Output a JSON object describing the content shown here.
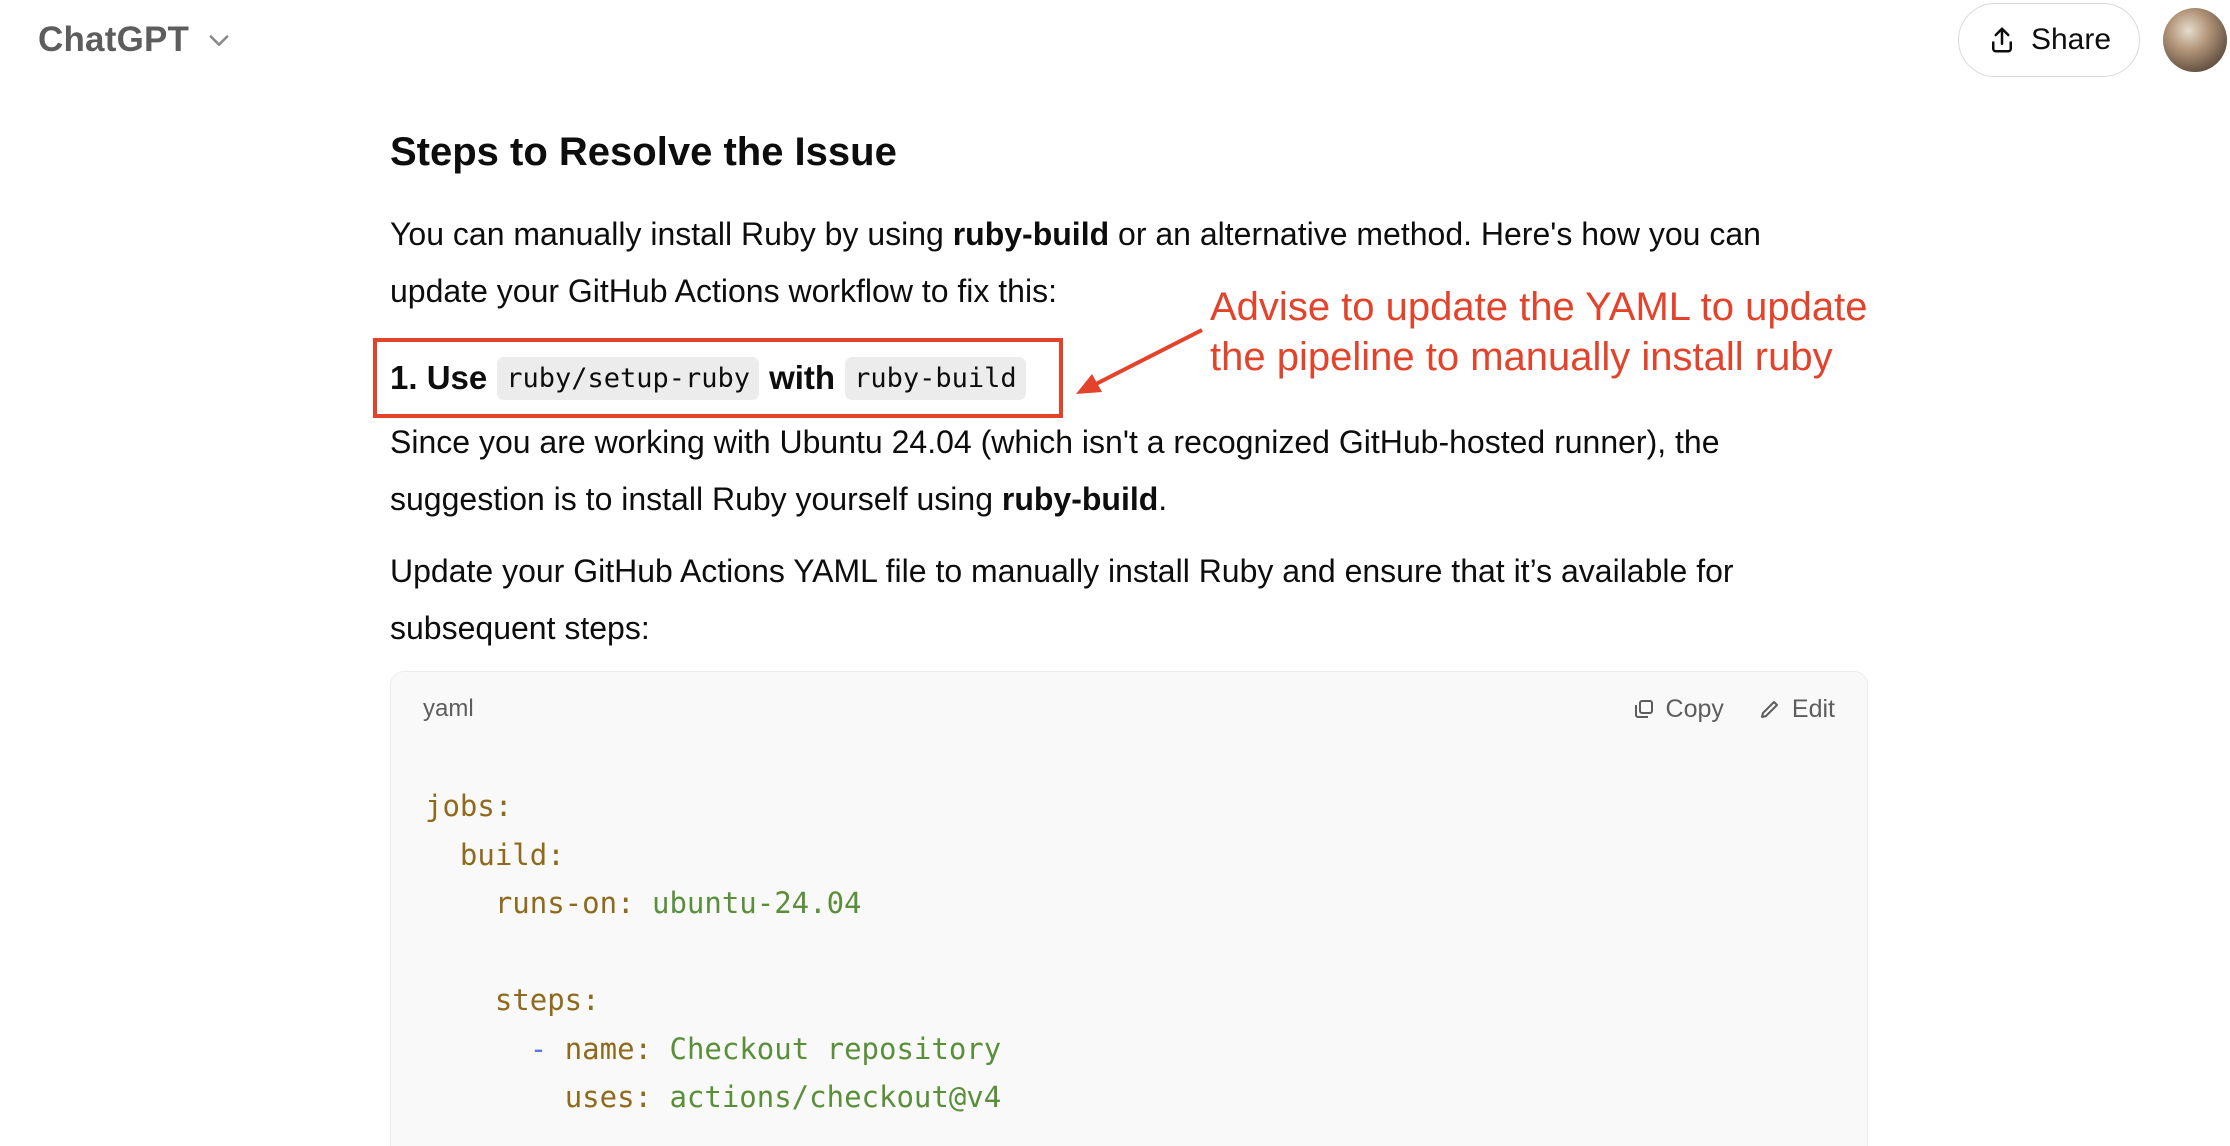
{
  "header": {
    "brand": "ChatGPT",
    "share_label": "Share"
  },
  "content": {
    "heading": "Steps to Resolve the Issue",
    "p1_a": "You can manually install Ruby by using ",
    "p1_bold": "ruby-build",
    "p1_b": " or an alternative method. Here's how you can update your GitHub Actions workflow to fix this:",
    "step_prefix": "1. Use",
    "step_code1": "ruby/setup-ruby",
    "step_mid": "with",
    "step_code2": "ruby-build",
    "p2_a": "Since you are working with Ubuntu 24.04 (which isn't a recognized GitHub-hosted runner), the suggestion is to install Ruby yourself using ",
    "p2_bold": "ruby-build",
    "p2_b": ".",
    "p3": "Update your GitHub Actions YAML file to manually install Ruby and ensure that it’s available for subsequent steps:"
  },
  "annotation": {
    "line1": "Advise to update the YAML to update",
    "line2": "the pipeline to manually install ruby",
    "color": "#e2432a"
  },
  "codeblock": {
    "language": "yaml",
    "copy_label": "Copy",
    "edit_label": "Edit",
    "lines": [
      {
        "key": "jobs:",
        "val": ""
      },
      {
        "key": "build:",
        "val": ""
      },
      {
        "key": "runs-on:",
        "val": "ubuntu-24.04"
      },
      {
        "key": "steps:",
        "val": ""
      },
      {
        "dash": "-",
        "key": "name:",
        "val": "Checkout repository"
      },
      {
        "key": "uses:",
        "val": "actions/checkout@v4"
      }
    ]
  }
}
